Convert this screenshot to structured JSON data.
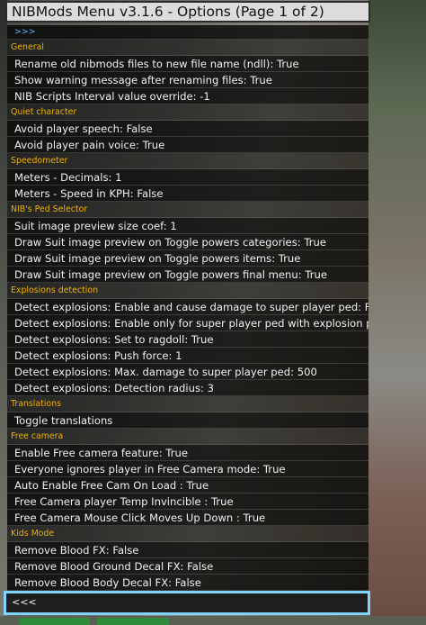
{
  "window": {
    "title": "NIBMods Menu v3.1.6 - Options (Page 1 of 2)"
  },
  "nav": {
    "next": ">>>",
    "prev": "<<<"
  },
  "sections": [
    {
      "header": "General",
      "items": [
        "Rename old nibmods files to new file name (ndll): True",
        "Show warning message after renaming files: True",
        "NIB Scripts Interval value override: -1"
      ]
    },
    {
      "header": "Quiet character",
      "items": [
        "Avoid player speech: False",
        "Avoid player pain voice: True"
      ]
    },
    {
      "header": "Speedometer",
      "items": [
        "Meters - Decimals: 1",
        "Meters - Speed in KPH: False"
      ]
    },
    {
      "header": "NIB's Ped Selector",
      "items": [
        "Suit image preview size coef: 1",
        "Draw Suit image preview on Toggle powers categories: True",
        "Draw Suit image preview on Toggle powers items: True",
        "Draw Suit image preview on Toggle powers final menu: True"
      ]
    },
    {
      "header": "Explosions detection",
      "items": [
        "Detect explosions: Enable and cause damage to super player ped: False",
        "Detect explosions: Enable only for super player ped with explosion proof: False",
        "Detect explosions: Set to ragdoll: True",
        "Detect explosions: Push force: 1",
        "Detect explosions: Max. damage to super player ped: 500",
        "Detect explosions: Detection radius: 3"
      ]
    },
    {
      "header": "Translations",
      "items": [
        "Toggle translations"
      ]
    },
    {
      "header": "Free camera",
      "items": [
        "Enable Free camera feature: True",
        "Everyone ignores player in Free Camera mode: True",
        "Auto Enable Free Cam On Load : True",
        "Free Camera player Temp Invincible : True",
        "Free Camera Mouse Click Moves Up Down : True"
      ]
    },
    {
      "header": "Kids Mode",
      "items": [
        "Remove Blood FX: False",
        "Remove Blood Ground Decal FX: False",
        "Remove Blood Body Decal FX: False"
      ]
    }
  ]
}
